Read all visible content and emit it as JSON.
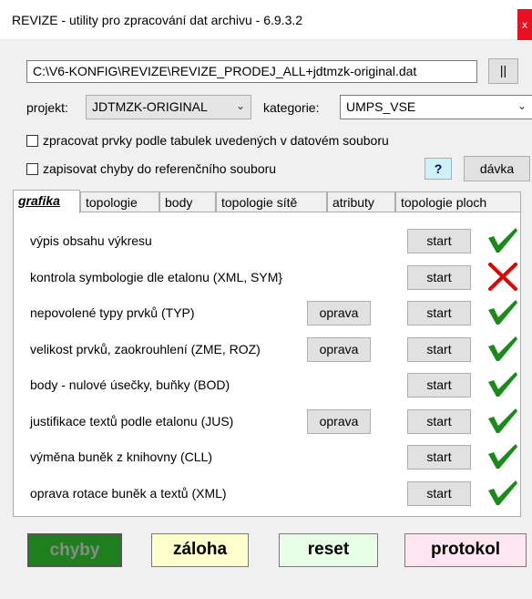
{
  "window": {
    "title": "REVIZE - utility pro zpracování dat archivu - 6.9.3.2",
    "close_glyph": "x"
  },
  "file": {
    "path": "C:\\V6-KONFIG\\REVIZE\\REVIZE_PRODEJ_ALL+jdtmzk-original.dat",
    "browse_label": "||"
  },
  "filters": {
    "projekt_label": "projekt:",
    "projekt_value": "JDTMZK-ORIGINAL",
    "kategorie_label": "kategorie:",
    "kategorie_value": "UMPS_VSE"
  },
  "options": {
    "opt1_label": "zpracovat prvky podle tabulek uvedených v datovém souboru",
    "opt1_checked": false,
    "opt2_label": "zapisovat chyby do referenčního souboru",
    "opt2_checked": false,
    "help_label": "?",
    "batch_label": "dávka"
  },
  "tabs": [
    "grafika",
    "topologie",
    "body",
    "topologie sítě",
    "atributy",
    "topologie ploch"
  ],
  "active_tab": "grafika",
  "rows": [
    {
      "label": "výpis obsahu výkresu",
      "fix": "",
      "start": "start",
      "status": "ok"
    },
    {
      "label": "kontrola symbologie dle etalonu (XML, SYM}",
      "fix": "",
      "start": "start",
      "status": "error"
    },
    {
      "label": "nepovolené typy prvků (TYP)",
      "fix": "oprava",
      "start": "start",
      "status": "ok"
    },
    {
      "label": "velikost prvků, zaokrouhlení (ZME, ROZ)",
      "fix": "oprava",
      "start": "start",
      "status": "ok"
    },
    {
      "label": "body - nulové úsečky, buňky (BOD)",
      "fix": "",
      "start": "start",
      "status": "ok"
    },
    {
      "label": "justifikace textů podle etalonu (JUS)",
      "fix": "oprava",
      "start": "start",
      "status": "ok"
    },
    {
      "label": "výměna buněk z knihovny (CLL)",
      "fix": "",
      "start": "start",
      "status": "ok"
    },
    {
      "label": "oprava rotace buněk a textů (XML)",
      "fix": "",
      "start": "start",
      "status": "ok"
    }
  ],
  "status_icons": {
    "ok": "check-icon",
    "error": "cross-icon"
  },
  "colors": {
    "ok": "#1a8a1a",
    "error": "#e00000"
  },
  "actions": {
    "chyby": "chyby",
    "zaloha": "záloha",
    "reset": "reset",
    "protokol": "protokol"
  }
}
